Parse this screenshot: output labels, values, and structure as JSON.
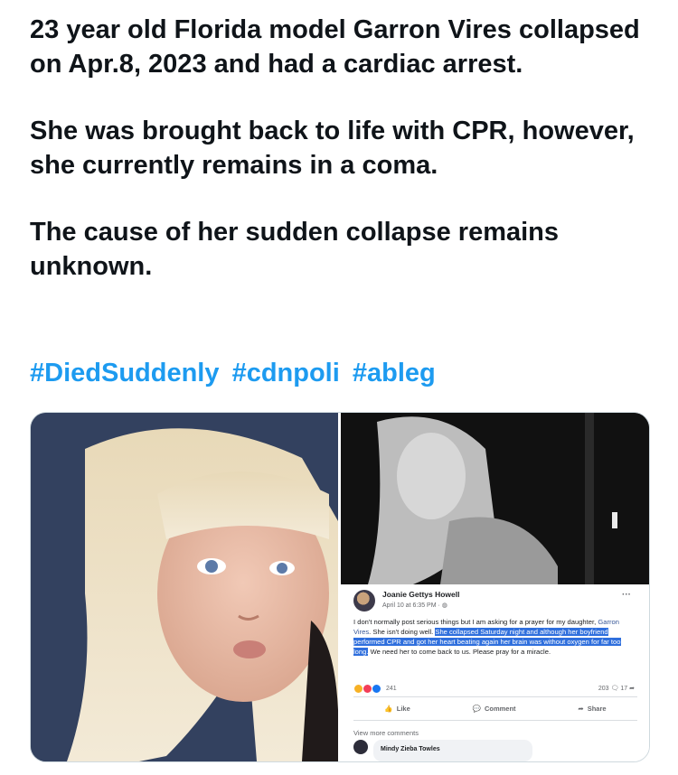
{
  "tweet": {
    "paragraphs": [
      "23 year old Florida model Garron Vires collapsed on Apr.8, 2023 and had a cardiac arrest.",
      "She was brought back to life with CPR, however, she currently remains in a coma.",
      "The cause of her sudden collapse remains unknown."
    ],
    "hashtags": [
      "#DiedSuddenly",
      "#cdnpoli",
      "#ableg"
    ],
    "link_color": "#1d9bf0"
  },
  "fb_post": {
    "author": "Joanie Gettys Howell",
    "time": "April 10 at 6:35 PM · ",
    "more": "···",
    "body_1": "I don't normally post serious things but I am asking for a prayer for my daughter, ",
    "tagged": "Garron Vires",
    "body_2": ". She isn't doing well. ",
    "highlighted": "She collapsed Saturday night and although her boyfriend performed CPR and got her heart beating again her brain was without oxygen for far too long.",
    "body_3": " We need her to come back to us. Please pray for a miracle.",
    "reaction_count": "241",
    "comment_count": "203",
    "share_count": "17",
    "like_label": "Like",
    "comment_label": "Comment",
    "share_label": "Share",
    "view_more": "View more comments",
    "commenter": "Mindy Zieba Towles",
    "highlight_color": "#2f6fdd"
  }
}
